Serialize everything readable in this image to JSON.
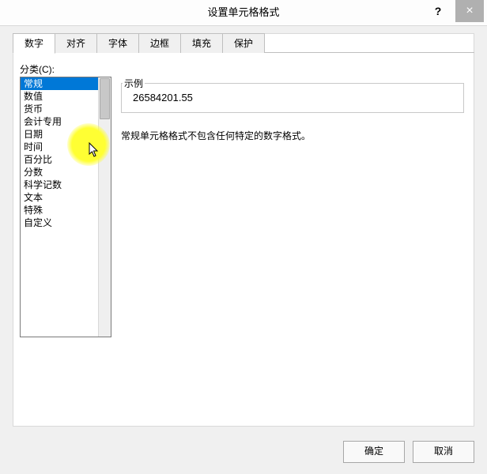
{
  "titlebar": {
    "title": "设置单元格格式",
    "help": "?",
    "close": "×"
  },
  "tabs": {
    "items": [
      {
        "label": "数字"
      },
      {
        "label": "对齐"
      },
      {
        "label": "字体"
      },
      {
        "label": "边框"
      },
      {
        "label": "填充"
      },
      {
        "label": "保护"
      }
    ]
  },
  "category": {
    "label": "分类(C):",
    "items": [
      "常规",
      "数值",
      "货币",
      "会计专用",
      "日期",
      "时间",
      "百分比",
      "分数",
      "科学记数",
      "文本",
      "特殊",
      "自定义"
    ]
  },
  "sample": {
    "label": "示例",
    "value": "26584201.55"
  },
  "description": "常规单元格格式不包含任何特定的数字格式。",
  "buttons": {
    "ok": "确定",
    "cancel": "取消"
  }
}
